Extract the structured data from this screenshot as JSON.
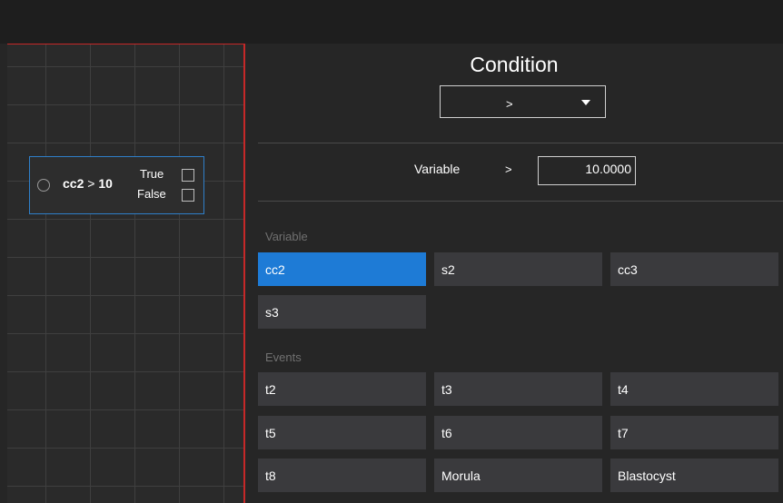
{
  "node": {
    "variable": "cc2",
    "operator": ">",
    "value": "10",
    "true_label": "True",
    "false_label": "False"
  },
  "condition_panel": {
    "title": "Condition",
    "operator_selected": ">",
    "expression": {
      "variable_label": "Variable",
      "operator": ">",
      "value": "10.0000"
    }
  },
  "variable_section": {
    "label": "Variable",
    "items": [
      "cc2",
      "s2",
      "cc3",
      "s3"
    ],
    "selected": "cc2"
  },
  "events_section": {
    "label": "Events",
    "items": [
      "t2",
      "t3",
      "t4",
      "t5",
      "t6",
      "t7",
      "t8",
      "Morula",
      "Blastocyst"
    ]
  },
  "colors": {
    "accent": "#1e7bd6",
    "node_border": "#2f7fc9",
    "canvas_border": "#c62828",
    "tile": "#3a3a3d"
  }
}
